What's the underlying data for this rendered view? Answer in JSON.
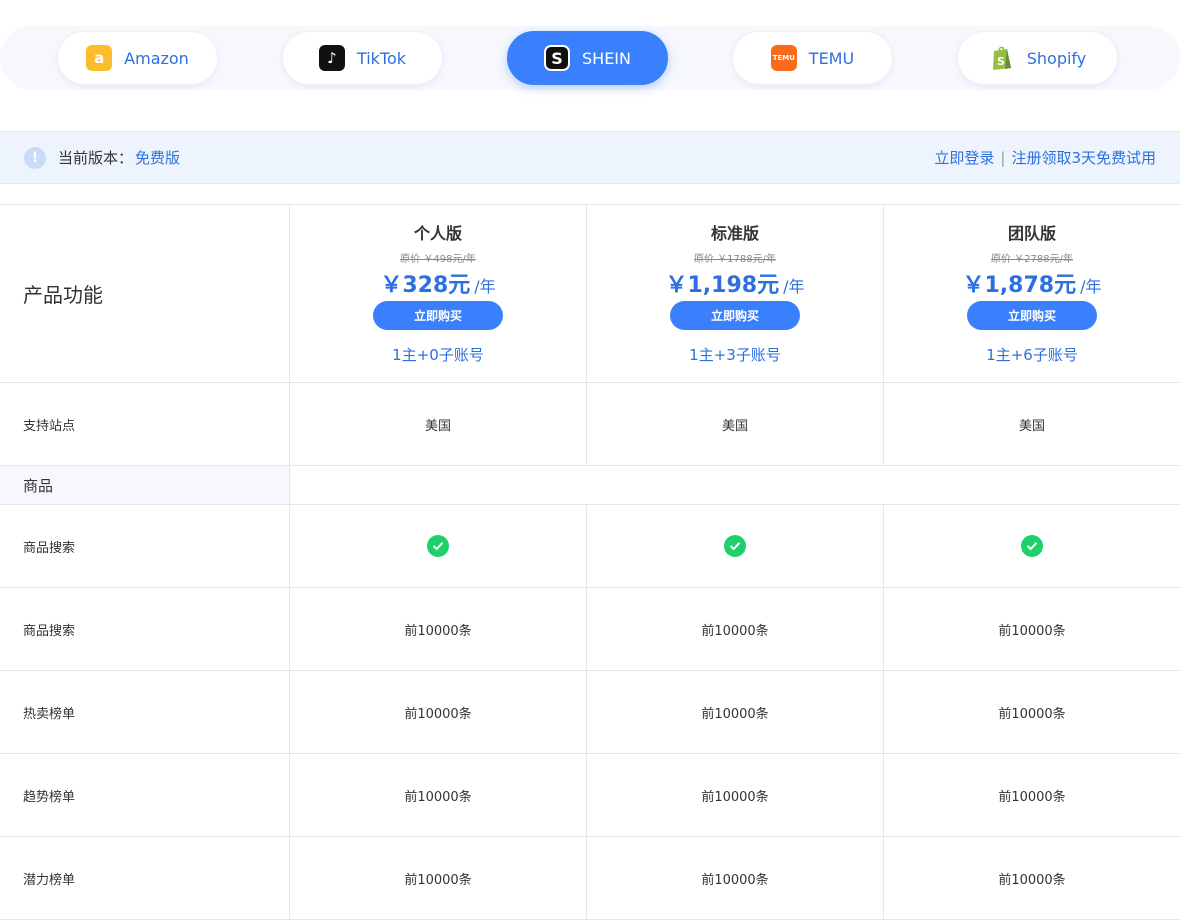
{
  "platform_tabs": [
    {
      "label": "Amazon",
      "icon": "amazon-icon",
      "active": false
    },
    {
      "label": "TikTok",
      "icon": "tiktok-icon",
      "active": false
    },
    {
      "label": "SHEIN",
      "icon": "shein-icon",
      "active": true
    },
    {
      "label": "TEMU",
      "icon": "temu-icon",
      "active": false
    },
    {
      "label": "Shopify",
      "icon": "shopify-icon",
      "active": false
    }
  ],
  "version_bar": {
    "label": "当前版本：",
    "value": "免费版",
    "login_link": "立即登录",
    "separator": "|",
    "register_link": "注册领取3天免费试用"
  },
  "table": {
    "header_label": "产品功能",
    "plans": [
      {
        "name": "个人版",
        "original_price": "原价 ￥498元/年",
        "price": "￥328元",
        "unit": "/年",
        "buy_label": "立即购买",
        "accounts": "1主+0子账号"
      },
      {
        "name": "标准版",
        "original_price": "原价 ￥1788元/年",
        "price": "￥1,198元",
        "unit": "/年",
        "buy_label": "立即购买",
        "accounts": "1主+3子账号"
      },
      {
        "name": "团队版",
        "original_price": "原价 ￥2788元/年",
        "price": "￥1,878元",
        "unit": "/年",
        "buy_label": "立即购买",
        "accounts": "1主+6子账号"
      }
    ],
    "site_row": {
      "label": "支持站点",
      "values": [
        "美国",
        "美国",
        "美国"
      ]
    },
    "section": "商品",
    "feature_rows": [
      {
        "label": "商品搜索",
        "check": true,
        "values": [
          "",
          "",
          ""
        ]
      },
      {
        "label": "商品搜索",
        "check": false,
        "values": [
          "前10000条",
          "前10000条",
          "前10000条"
        ]
      },
      {
        "label": "热卖榜单",
        "check": false,
        "values": [
          "前10000条",
          "前10000条",
          "前10000条"
        ]
      },
      {
        "label": "趋势榜单",
        "check": false,
        "values": [
          "前10000条",
          "前10000条",
          "前10000条"
        ]
      },
      {
        "label": "潜力榜单",
        "check": false,
        "values": [
          "前10000条",
          "前10000条",
          "前10000条"
        ]
      }
    ]
  },
  "colors": {
    "accent": "#3a7ffc",
    "link": "#2e6fe0",
    "check": "#1ed06a"
  }
}
